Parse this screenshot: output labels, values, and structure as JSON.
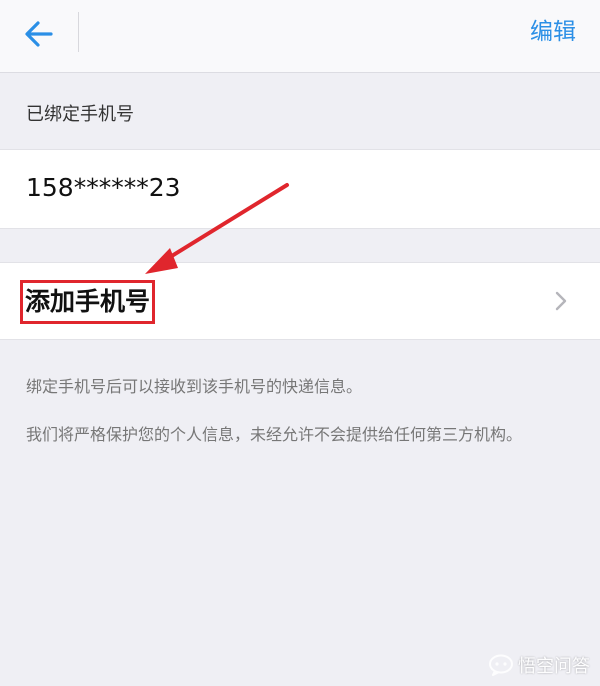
{
  "header": {
    "edit_label": "编辑"
  },
  "bound_section": {
    "label": "已绑定手机号",
    "phone": "158******23"
  },
  "add_row": {
    "label": "添加手机号"
  },
  "notes": {
    "line1": "绑定手机号后可以接收到该手机号的快递信息。",
    "line2": "我们将严格保护您的个人信息，未经允许不会提供给任何第三方机构。"
  },
  "watermark": {
    "text": "悟空问答"
  },
  "colors": {
    "accent": "#2b8fe6",
    "highlight": "#e0262d",
    "background": "#efeff4"
  },
  "icons": {
    "back": "arrow-left-icon",
    "chevron": "chevron-right-icon",
    "watermark": "chat-bubble-icon"
  }
}
